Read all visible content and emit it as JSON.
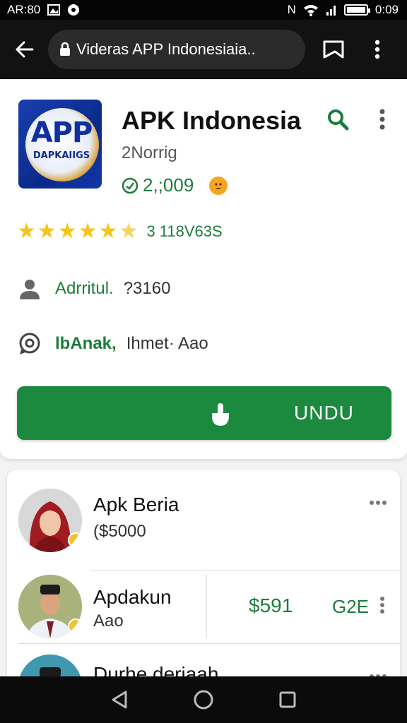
{
  "status_bar": {
    "left_text": "AR:80",
    "right_text": "0:09",
    "network_label": "N"
  },
  "browser": {
    "url": "Videras APP Indonesiaia.."
  },
  "app": {
    "icon_text_main": "APP",
    "icon_text_sub": "DAPKAIIGS",
    "title": "APK Indonesia",
    "subtitle": "2Norrig",
    "count": "2,;009",
    "rating_stars": 5.5,
    "rating_count": "3 118V63S",
    "info_rows": [
      {
        "icon": "person-icon",
        "label": "Adrritul.",
        "value": "?3160"
      },
      {
        "icon": "chat-icon",
        "label": "lbAnak,",
        "value": "Ihmet· Aao"
      }
    ],
    "download_label": "UNDU"
  },
  "list": {
    "items": [
      {
        "name": "Apk Beria",
        "sub": "($5000"
      },
      {
        "name": "Apdakun",
        "sub": "Aao",
        "price": "$591",
        "tag": "G2E"
      },
      {
        "name": "Durhe deriaah",
        "sub": ""
      }
    ]
  },
  "colors": {
    "accent_green": "#1b8a3e",
    "text_green": "#1c7d3a",
    "star_yellow": "#f5c518"
  }
}
